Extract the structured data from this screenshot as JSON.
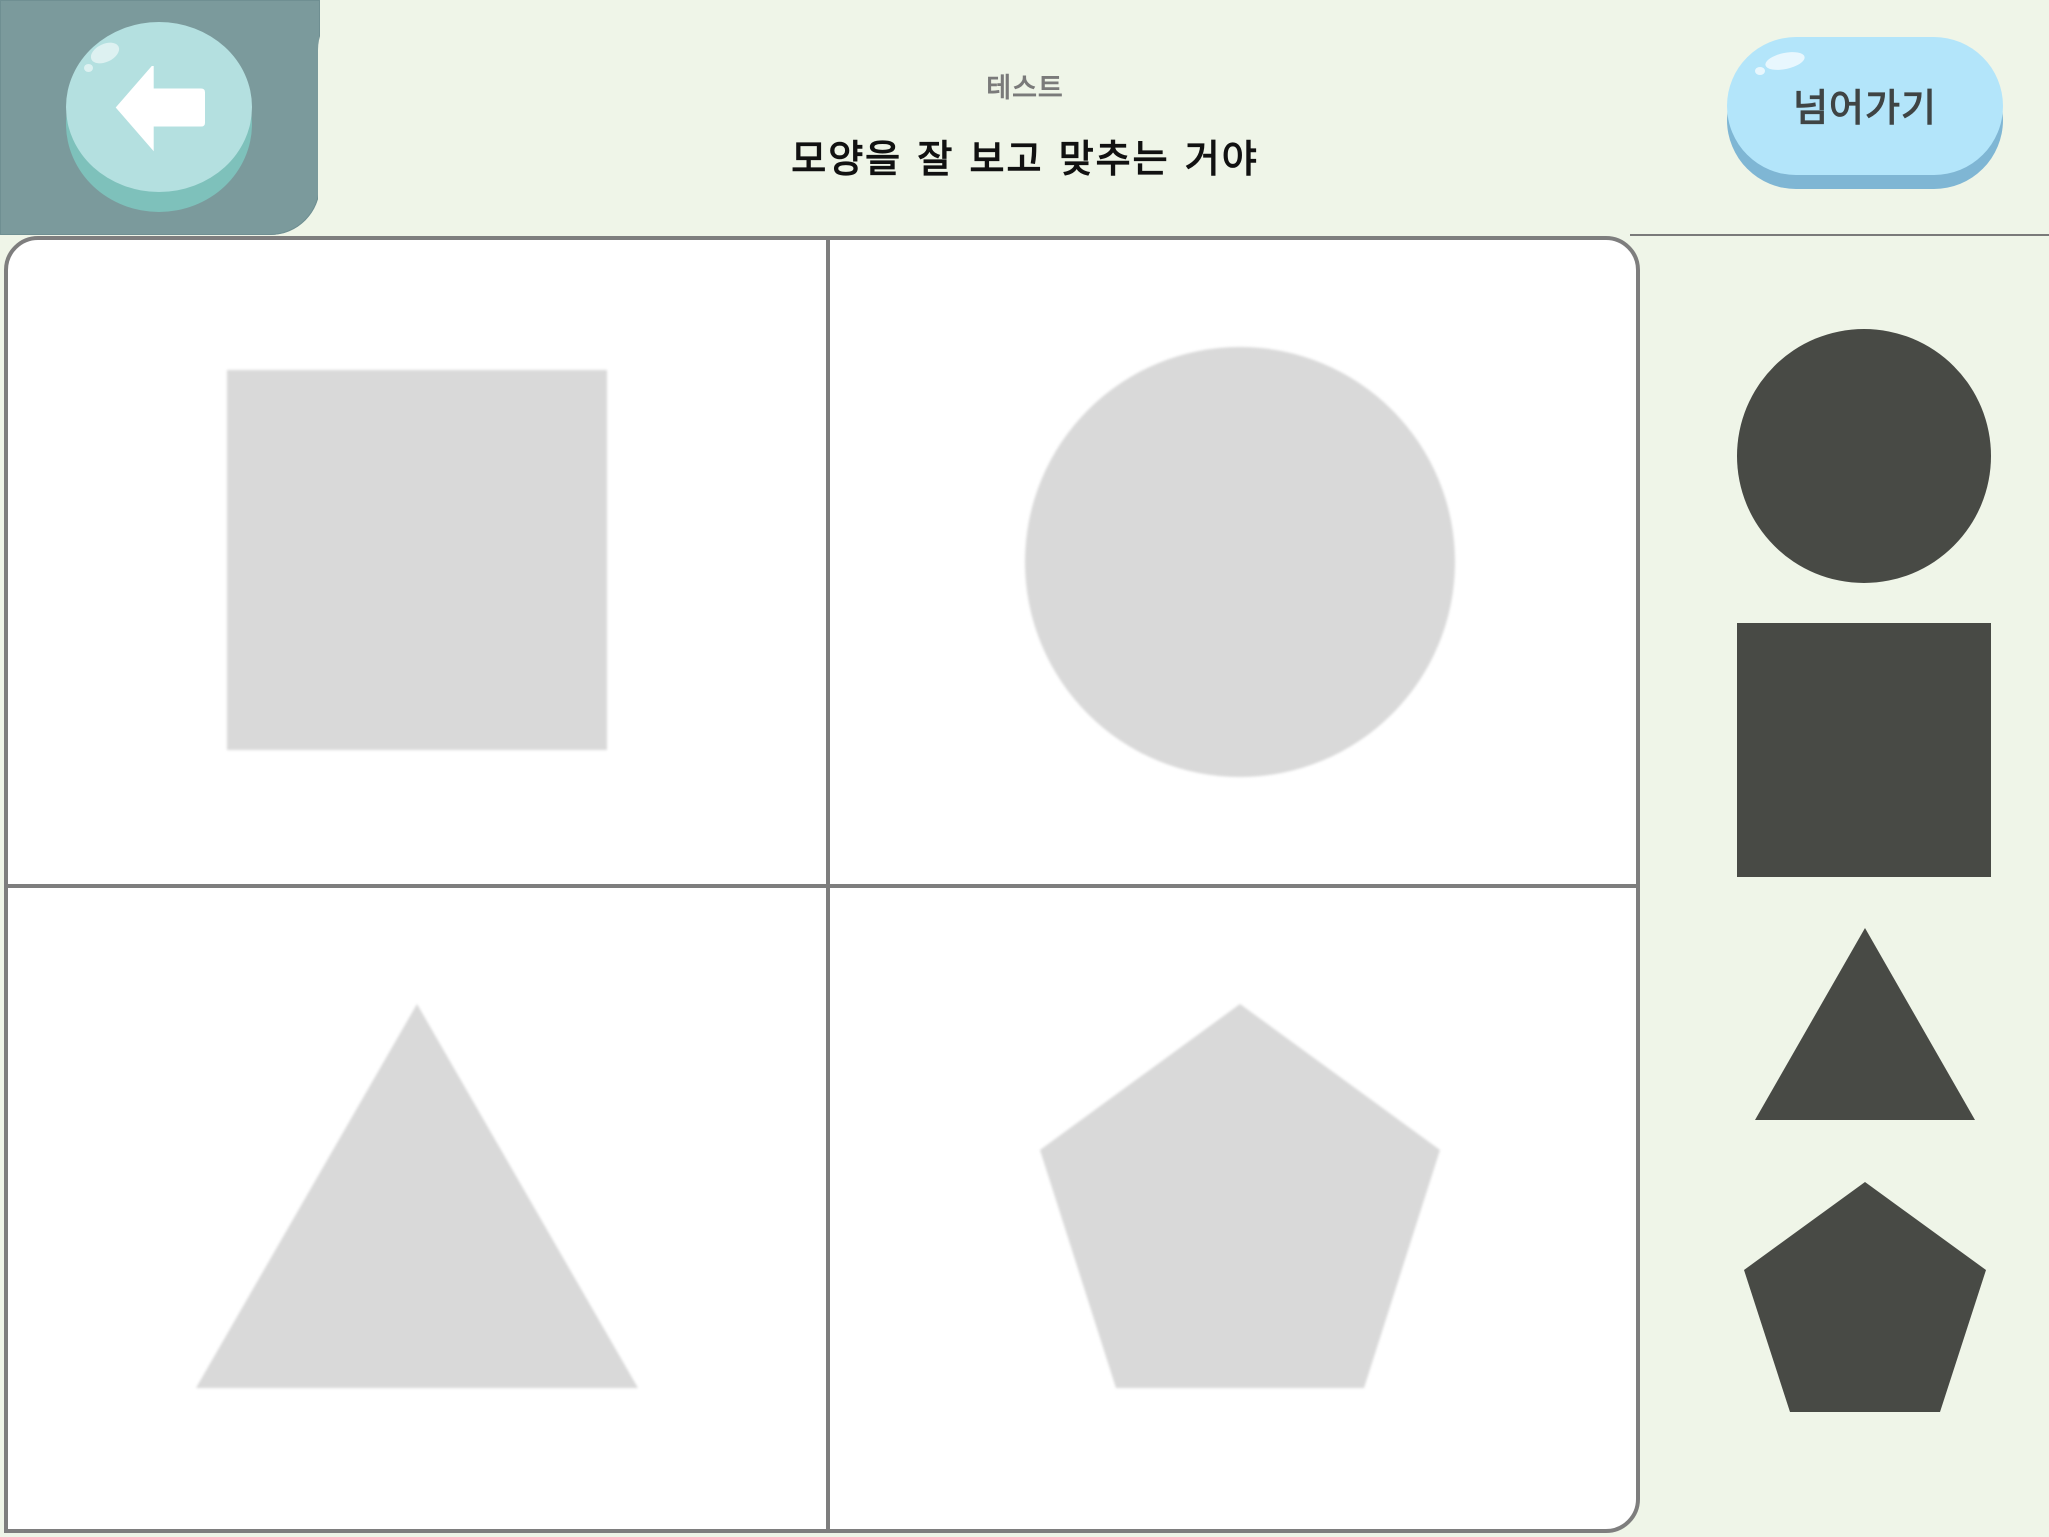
{
  "header": {
    "subtitle": "테스트",
    "title": "모양을 잘 보고 맞추는 거야"
  },
  "back_button": {
    "icon": "arrow-left-icon"
  },
  "skip_button": {
    "label": "넘어가기"
  },
  "board": {
    "targets": [
      {
        "shape": "square"
      },
      {
        "shape": "circle"
      },
      {
        "shape": "triangle"
      },
      {
        "shape": "pentagon"
      }
    ],
    "target_color": "#d9d9d9"
  },
  "palette": {
    "pieces": [
      {
        "shape": "circle"
      },
      {
        "shape": "square"
      },
      {
        "shape": "triangle"
      },
      {
        "shape": "pentagon"
      }
    ],
    "piece_color": "#484a45"
  },
  "colors": {
    "background": "#eff5e8",
    "back_panel": "#7b9a9c",
    "back_button": "#b4e0e0",
    "skip_button": "#b3e5fa",
    "grid_line": "#7e7e7e"
  }
}
